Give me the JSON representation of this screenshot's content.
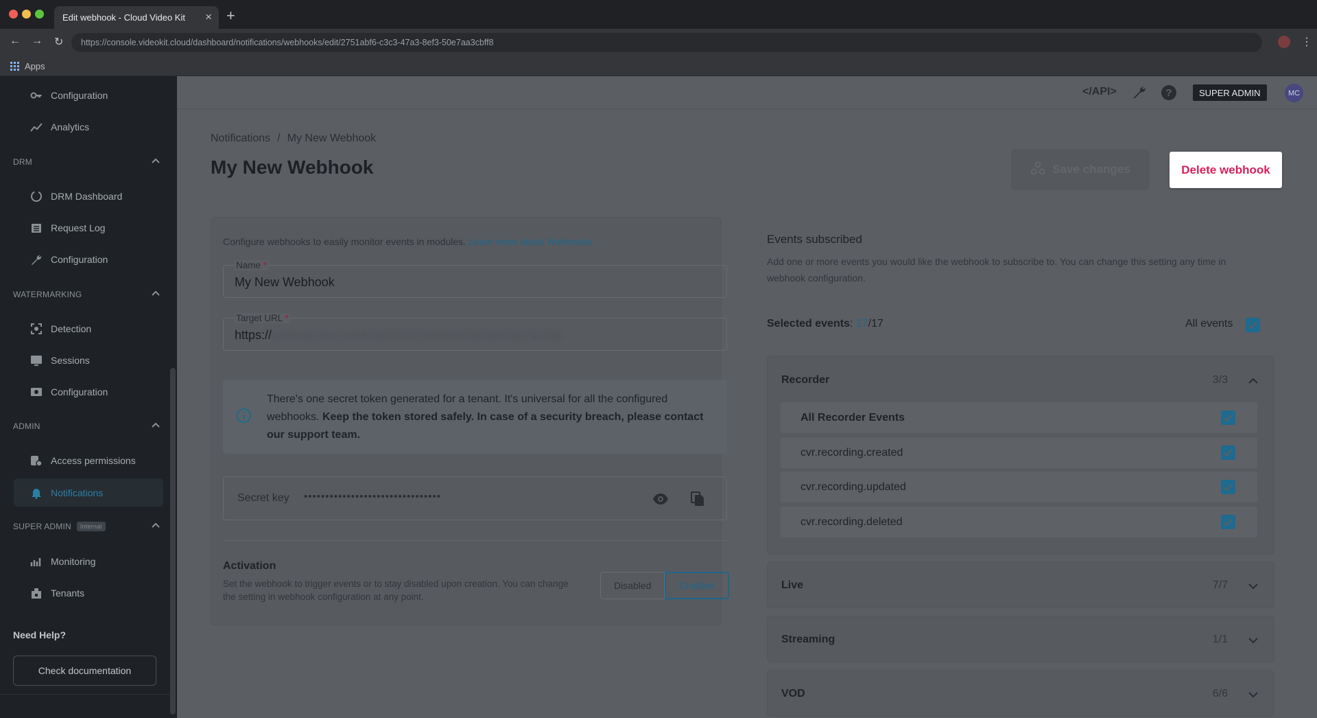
{
  "browser": {
    "tab_title": "Edit webhook - Cloud Video Kit",
    "url": "https://console.videokit.cloud/dashboard/notifications/webhooks/edit/2751abf6-c3c3-47a3-8ef3-50e7aa3cbff8",
    "bookmark_apps": "Apps"
  },
  "sidebar": {
    "top_items": [
      {
        "label": "Configuration",
        "icon": "key-icon"
      },
      {
        "label": "Analytics",
        "icon": "chart-line-icon"
      }
    ],
    "drm": {
      "title": "DRM",
      "items": [
        {
          "label": "DRM Dashboard",
          "icon": "circle-dashboard-icon"
        },
        {
          "label": "Request Log",
          "icon": "log-icon"
        },
        {
          "label": "Configuration",
          "icon": "wrench-icon"
        }
      ]
    },
    "watermarking": {
      "title": "WATERMARKING",
      "items": [
        {
          "label": "Detection",
          "icon": "detection-icon"
        },
        {
          "label": "Sessions",
          "icon": "sessions-icon"
        },
        {
          "label": "Configuration",
          "icon": "settings-icon"
        }
      ]
    },
    "admin": {
      "title": "ADMIN",
      "items": [
        {
          "label": "Access permissions",
          "icon": "lock-gear-icon"
        },
        {
          "label": "Notifications",
          "icon": "bell-icon"
        }
      ]
    },
    "super_admin": {
      "title": "SUPER ADMIN",
      "badge": "Internal",
      "items": [
        {
          "label": "Monitoring",
          "icon": "monitoring-icon"
        },
        {
          "label": "Tenants",
          "icon": "tenants-icon"
        }
      ]
    },
    "need_help": "Need Help?",
    "check_docs": "Check documentation"
  },
  "topbar": {
    "api_label": "</API>",
    "super_admin": "SUPER ADMIN",
    "avatar_initials": "MC"
  },
  "breadcrumb": {
    "parent": "Notifications",
    "separator": "/",
    "current": "My New Webhook"
  },
  "page_title": "My New Webhook",
  "actions": {
    "save": "Save changes",
    "delete": "Delete webhook"
  },
  "form": {
    "intro": "Configure webhooks to easily monitor events in modules.",
    "learn_more": "Learn more about Webhooks.",
    "name_label": "Name",
    "name_value": "My New Webhook",
    "url_label": "Target URL",
    "url_prefix": "https://",
    "url_rest": "webhook-test.com/b2bd3351074954f0b1983ee438c7ac16a",
    "required_mark": "*",
    "info_normal": "There's one secret token generated for a tenant. It's universal for all the configured webhooks.",
    "info_bold": "Keep the token stored safely. In case of a security breach, please contact our support team.",
    "secret_label": "Secret key",
    "secret_value": "••••••••••••••••••••••••••••••••",
    "activation_title": "Activation",
    "activation_desc": "Set the webhook to trigger events or to stay disabled upon creation. You can change the setting in webhook configuration at any point.",
    "disabled": "Disabled",
    "enabled": "Enabled"
  },
  "events": {
    "title": "Events subscribed",
    "desc": "Add one or more events you would like the webhook to subscribe to. You can change this setting any time in webhook configuration.",
    "selected_label": "Selected events",
    "selected_count": "17",
    "selected_total": "/17",
    "all_events": "All events",
    "groups": [
      {
        "name": "Recorder",
        "count": "3/3",
        "expanded": true,
        "rows": [
          "All Recorder Events",
          "cvr.recording.created",
          "cvr.recording.updated",
          "cvr.recording.deleted"
        ]
      },
      {
        "name": "Live",
        "count": "7/7",
        "expanded": false
      },
      {
        "name": "Streaming",
        "count": "1/1",
        "expanded": false
      },
      {
        "name": "VOD",
        "count": "6/6",
        "expanded": false
      }
    ]
  },
  "colors": {
    "accent": "#20668a",
    "danger": "#d9205a",
    "sidebar_bg": "#1e2226"
  }
}
